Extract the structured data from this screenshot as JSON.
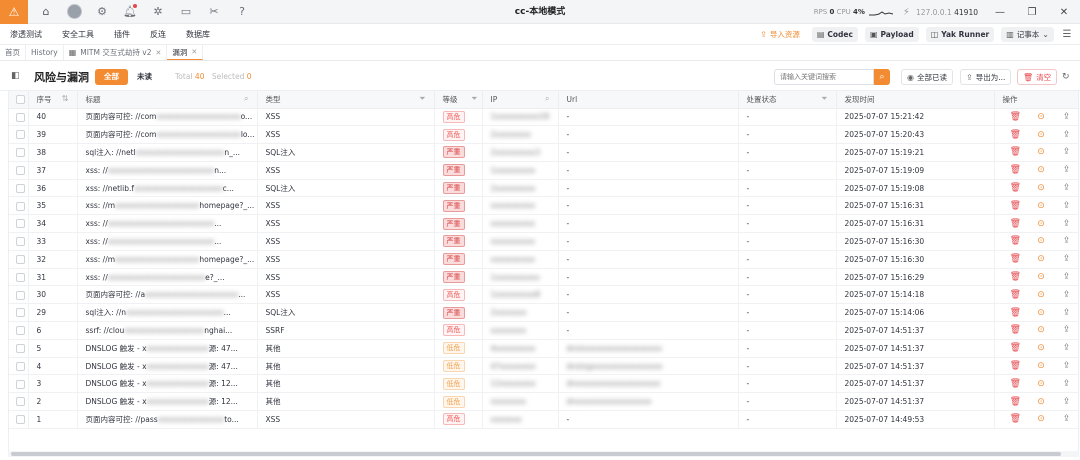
{
  "window": {
    "title": "cc-本地模式",
    "rps_label": "RPS",
    "rps_value": "0",
    "cpu_label": "CPU",
    "cpu_value": "4%",
    "ip": "127.0.0.1",
    "port": "41910"
  },
  "titlebar_icons": [
    "home-icon",
    "user-icon",
    "settings-icon",
    "bell-icon",
    "bug-icon",
    "terminal-icon",
    "tools-icon",
    "help-icon"
  ],
  "menu": {
    "items": [
      "渗透测试",
      "安全工具",
      "插件",
      "反连",
      "数据库"
    ],
    "import": "导入资源",
    "codec": "Codec",
    "payload": "Payload",
    "yak_runner": "Yak Runner",
    "notes": "记事本"
  },
  "tabs": {
    "home": "首页",
    "history": "History",
    "mitm": "MITM 交互式劫持 v2",
    "vuln": "漏洞"
  },
  "toolbar": {
    "title": "风险与漏洞",
    "all": "全部",
    "unread": "未读",
    "total_label": "Total",
    "total_value": "40",
    "selected_label": "Selected",
    "selected_value": "0",
    "search_placeholder": "请输入关键词搜索",
    "mark_all_read": "全部已读",
    "export": "导出为...",
    "clear": "清空"
  },
  "columns": {
    "seq": "序号",
    "title": "标题",
    "type": "类型",
    "level": "等级",
    "ip": "IP",
    "url": "Url",
    "status": "处置状态",
    "time": "发现时间",
    "ops": "操作"
  },
  "rows": [
    {
      "id": "40",
      "title_prefix": "页面内容可控: //com",
      "title_blur": "xxxxxxxxxxxxxxxxxxx",
      "title_suffix": "o...",
      "type": "XSS",
      "level": "高危",
      "sev": "high",
      "ip_blur": "1xxxxxxxxxx18",
      "url": "-",
      "url_blur": "",
      "status": "-",
      "time": "2025-07-07 15:21:42"
    },
    {
      "id": "39",
      "title_prefix": "页面内容可控: //com",
      "title_blur": "xxxxxxxxxxxxxxxxxxx",
      "title_suffix": "lo...",
      "type": "XSS",
      "level": "高危",
      "sev": "high",
      "ip_blur": "2xxxxxxxx",
      "url": "-",
      "url_blur": "",
      "status": "-",
      "time": "2025-07-07 15:20:43"
    },
    {
      "id": "38",
      "title_prefix": "sql注入: //netl",
      "title_blur": "xxxxxxxxxxxxxxxxxxxx",
      "title_suffix": "n_...",
      "type": "SQL注入",
      "level": "严重",
      "sev": "crit",
      "ip_blur": "2xxxxxxxxx3",
      "url": "-",
      "url_blur": "",
      "status": "-",
      "time": "2025-07-07 15:19:21"
    },
    {
      "id": "37",
      "title_prefix": "xss: //",
      "title_blur": "xxxxxxxxxxxxxxxxxxxxxxxx",
      "title_suffix": "n...",
      "type": "XSS",
      "level": "严重",
      "sev": "crit",
      "ip_blur": "1xxxxxxxxx",
      "url": "-",
      "url_blur": "",
      "status": "-",
      "time": "2025-07-07 15:19:09"
    },
    {
      "id": "36",
      "title_prefix": "xss: //netlib.f",
      "title_blur": "xxxxxxxxxxxxxxxxxxxx",
      "title_suffix": "c...",
      "type": "SQL注入",
      "level": "严重",
      "sev": "crit",
      "ip_blur": "2xxxxxxxxx",
      "url": "-",
      "url_blur": "",
      "status": "-",
      "time": "2025-07-07 15:19:08"
    },
    {
      "id": "35",
      "title_prefix": "xss: //m",
      "title_blur": "xxxxxxxxxxxxxxxxxxx",
      "title_suffix": "homepage?_...",
      "type": "XSS",
      "level": "严重",
      "sev": "crit",
      "ip_blur": "xxxxxxxxxx",
      "url": "-",
      "url_blur": "",
      "status": "-",
      "time": "2025-07-07 15:16:31"
    },
    {
      "id": "34",
      "title_prefix": "xss: //",
      "title_blur": "xxxxxxxxxxxxxxxxxxxxxxxx",
      "title_suffix": "...",
      "type": "XSS",
      "level": "严重",
      "sev": "crit",
      "ip_blur": "xxxxxxxxxx",
      "url": "-",
      "url_blur": "",
      "status": "-",
      "time": "2025-07-07 15:16:31"
    },
    {
      "id": "33",
      "title_prefix": "xss: //",
      "title_blur": "xxxxxxxxxxxxxxxxxxxxxxxx",
      "title_suffix": "...",
      "type": "XSS",
      "level": "严重",
      "sev": "crit",
      "ip_blur": "xxxxxxxxxx",
      "url": "-",
      "url_blur": "",
      "status": "-",
      "time": "2025-07-07 15:16:30"
    },
    {
      "id": "32",
      "title_prefix": "xss: //m",
      "title_blur": "xxxxxxxxxxxxxxxxxxx",
      "title_suffix": "homepage?_...",
      "type": "XSS",
      "level": "严重",
      "sev": "crit",
      "ip_blur": "xxxxxxxxxx",
      "url": "-",
      "url_blur": "",
      "status": "-",
      "time": "2025-07-07 15:16:30"
    },
    {
      "id": "31",
      "title_prefix": "xss: //",
      "title_blur": "xxxxxxxxxxxxxxxxxxxxxx",
      "title_suffix": "e?_...",
      "type": "XSS",
      "level": "严重",
      "sev": "crit",
      "ip_blur": "1xxxxxxxxxx",
      "url": "-",
      "url_blur": "",
      "status": "-",
      "time": "2025-07-07 15:16:29"
    },
    {
      "id": "30",
      "title_prefix": "页面内容可控: //a",
      "title_blur": "xxxxxxxxxxxxxxxxxxxxx",
      "title_suffix": "...",
      "type": "XSS",
      "level": "高危",
      "sev": "high",
      "ip_blur": "1xxxxxxxxx8",
      "url": "-",
      "url_blur": "",
      "status": "-",
      "time": "2025-07-07 15:14:18"
    },
    {
      "id": "29",
      "title_prefix": "sql注入: //n",
      "title_blur": "xxxxxxxxxxxxxxxxxxxxxx",
      "title_suffix": "...",
      "type": "SQL注入",
      "level": "严重",
      "sev": "crit",
      "ip_blur": "2xxxxxxx",
      "url": "-",
      "url_blur": "",
      "status": "-",
      "time": "2025-07-07 15:14:06"
    },
    {
      "id": "6",
      "title_prefix": "ssrf: //clou",
      "title_blur": "xxxxxxxxxxxxxxxxxx",
      "title_suffix": "nghai...",
      "type": "SSRF",
      "level": "高危",
      "sev": "high",
      "ip_blur": "xxxxxxxx",
      "url": "-",
      "url_blur": "",
      "status": "-",
      "time": "2025-07-07 14:51:37"
    },
    {
      "id": "5",
      "title_prefix": "DNSLOG 触发 - x",
      "title_blur": "xxxxxxxxxxxxxx",
      "title_suffix": "源: 47...",
      "type": "其他",
      "level": "低危",
      "sev": "low",
      "ip_blur": "4xxxxxxxxx",
      "url": "",
      "url_blur": "dnslxxxxxxxxxxxxxxxxxx",
      "status": "-",
      "time": "2025-07-07 14:51:37"
    },
    {
      "id": "4",
      "title_prefix": "DNSLOG 触发 - x",
      "title_blur": "xxxxxxxxxxxxxx",
      "title_suffix": "源: 47...",
      "type": "其他",
      "level": "低危",
      "sev": "low",
      "ip_blur": "47xxxxxxxx",
      "url": "",
      "url_blur": "dnslogxxxxxxxxxxxxxxxx",
      "status": "-",
      "time": "2025-07-07 14:51:37"
    },
    {
      "id": "3",
      "title_prefix": "DNSLOG 触发 - x",
      "title_blur": "xxxxxxxxxxxxxx",
      "title_suffix": "源: 12...",
      "type": "其他",
      "level": "低危",
      "sev": "low",
      "ip_blur": "12xxxxxxxx",
      "url": "",
      "url_blur": "dnxxxxxxxxxxxxxxxxxxx",
      "status": "-",
      "time": "2025-07-07 14:51:37"
    },
    {
      "id": "2",
      "title_prefix": "DNSLOG 触发 - x",
      "title_blur": "xxxxxxxxxxxxxx",
      "title_suffix": "源: 12...",
      "type": "其他",
      "level": "低危",
      "sev": "low",
      "ip_blur": "xxxxxxxx",
      "url": "",
      "url_blur": "dnxxxxxxxxxxxxxxxxx",
      "status": "-",
      "time": "2025-07-07 14:51:37"
    },
    {
      "id": "1",
      "title_prefix": "页面内容可控: //pass",
      "title_blur": "xxxxxxxxxxxxxxx",
      "title_suffix": "to...",
      "type": "XSS",
      "level": "高危",
      "sev": "high",
      "ip_blur": "xxxxxxx",
      "url": "-",
      "url_blur": "",
      "status": "-",
      "time": "2025-07-07 14:49:53"
    }
  ]
}
